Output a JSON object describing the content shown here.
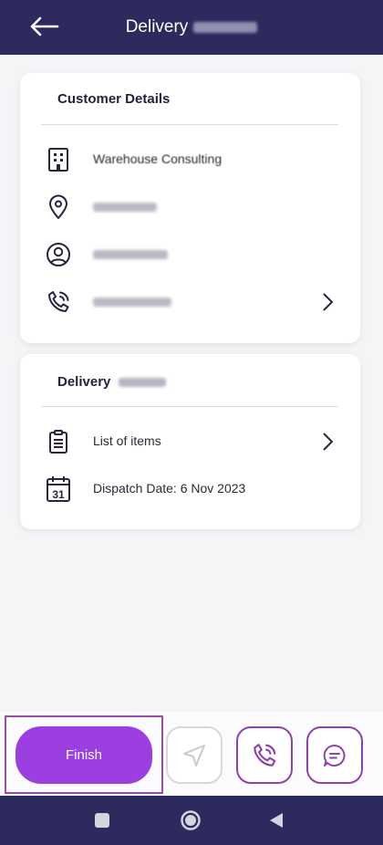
{
  "header": {
    "title": "Delivery",
    "back_icon": "arrow-left-icon"
  },
  "customer_details": {
    "title": "Customer Details",
    "rows": [
      {
        "icon": "building-icon",
        "text": "Warehouse Consulting"
      },
      {
        "icon": "location-pin-icon",
        "text": ""
      },
      {
        "icon": "user-icon",
        "text": ""
      },
      {
        "icon": "phone-icon",
        "text": ""
      }
    ]
  },
  "delivery_details": {
    "title": "Delivery",
    "list_items_label": "List of items",
    "dispatch_date_label": "Dispatch Date: 6 Nov 2023"
  },
  "actions": {
    "finish_label": "Finish",
    "navigate_icon": "navigation-arrow-icon",
    "call_icon": "phone-call-icon",
    "chat_icon": "chat-bubble-icon"
  },
  "colors": {
    "header_bg": "#2d2a5e",
    "accent": "#9b3fe0",
    "outline": "#8c43a8"
  }
}
